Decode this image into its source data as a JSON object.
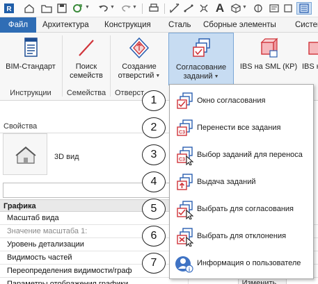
{
  "qat": {
    "icons": [
      "revit-home-icon",
      "open-folder-icon",
      "save-icon",
      "sync-icon",
      "undo-icon",
      "redo-icon",
      "print-icon",
      "measure-icon",
      "annotate-icon",
      "text-A-icon",
      "3d-view-icon",
      "section-icon",
      "thin-lines-icon"
    ],
    "text_icon_label": "A"
  },
  "tabs": [
    {
      "label": "Файл"
    },
    {
      "label": "Архитектура"
    },
    {
      "label": "Конструкция"
    },
    {
      "label": "Сталь"
    },
    {
      "label": "Сборные элементы"
    },
    {
      "label": "Систем"
    }
  ],
  "ribbon": {
    "buttons": [
      {
        "label": "BIM-Стандарт",
        "icon": "document-icon"
      },
      {
        "label_line1": "Поиск",
        "label_line2": "семейств",
        "icon": "search-line-icon"
      },
      {
        "label_line1": "Создание",
        "label_line2": "отверстий",
        "icon": "opening-icon"
      },
      {
        "label_line1": "Согласование",
        "label_line2": "заданий",
        "icon": "tasks-stack-icon"
      },
      {
        "label": "IBS на SML (КР)",
        "icon": "ibs-cube-icon"
      },
      {
        "label": "IBS на",
        "icon": "ibs-partial-icon"
      }
    ],
    "groups": [
      "Инструкции",
      "Семейства",
      "Отверст"
    ]
  },
  "properties": {
    "title": "Свойства",
    "type_name": "3D вид",
    "section": "Графика",
    "rows": [
      {
        "name": "Масштаб вида",
        "value": ""
      },
      {
        "name": "Значение масштаба    1:",
        "value": ""
      },
      {
        "name": "Уровень детализации",
        "value": ""
      },
      {
        "name": "Видимость частей",
        "value": ""
      },
      {
        "name": "Переопределения видимости/граф",
        "value": ""
      },
      {
        "name": "Параметры отображения графики",
        "value": "Изменить..."
      }
    ]
  },
  "menu": {
    "items": [
      {
        "num": "1",
        "label": "Окно согласования",
        "icon": "check-stack-icon"
      },
      {
        "num": "2",
        "label": "Перенести все задания",
        "icon": "c3-stack-icon"
      },
      {
        "num": "3",
        "label": "Выбор заданий для переноса",
        "icon": "c3-cursor-icon"
      },
      {
        "num": "4",
        "label": "Выдача заданий",
        "icon": "issue-up-icon"
      },
      {
        "num": "5",
        "label": "Выбрать для согласования",
        "icon": "check-cursor-icon"
      },
      {
        "num": "6",
        "label": "Выбрать для отклонения",
        "icon": "reject-cursor-icon"
      },
      {
        "num": "7",
        "label": "Информация о пользователе",
        "icon": "user-info-icon"
      }
    ]
  },
  "colors": {
    "file_tab": "#2f6db5",
    "active_button": "#c7dcf2",
    "icon_blue": "#2b5fb0",
    "icon_red": "#d0343a"
  }
}
